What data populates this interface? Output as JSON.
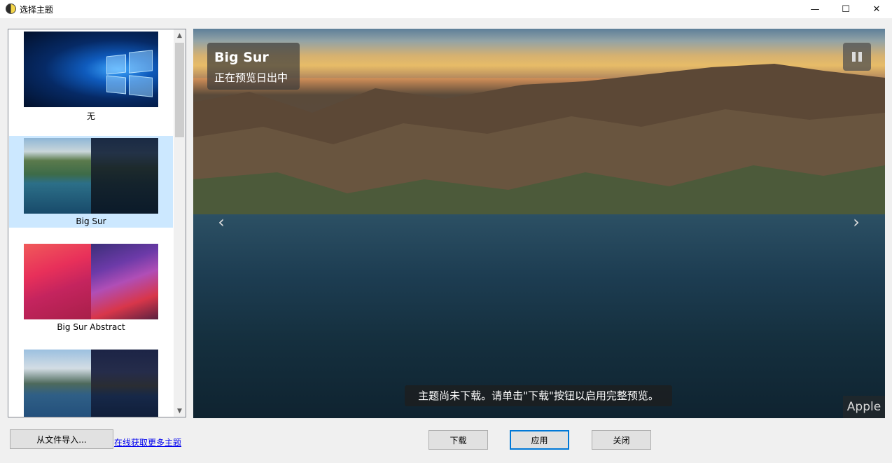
{
  "window": {
    "title": "选择主题",
    "controls": {
      "minimize": "—",
      "maximize": "☐",
      "close": "✕"
    }
  },
  "theme_list": {
    "items": [
      {
        "label": "无",
        "selected": false
      },
      {
        "label": "Big Sur",
        "selected": true
      },
      {
        "label": "Big Sur Abstract",
        "selected": false
      },
      {
        "label": "",
        "selected": false
      }
    ],
    "scroll_up": "▲",
    "scroll_down": "▼"
  },
  "preview": {
    "theme_name": "Big Sur",
    "status": "正在预览日出中",
    "prev_arrow": "‹",
    "next_arrow": "›",
    "caption": "主题尚未下载。请单击\"下载\"按钮以启用完整预览。",
    "credit": "Apple"
  },
  "footer": {
    "import_label": "从文件导入...",
    "more_link": "在线获取更多主题",
    "download_label": "下载",
    "apply_label": "应用",
    "close_label": "关闭"
  },
  "colors": {
    "selection": "#cce8ff",
    "accent": "#0078d7",
    "link": "#0000ee"
  }
}
